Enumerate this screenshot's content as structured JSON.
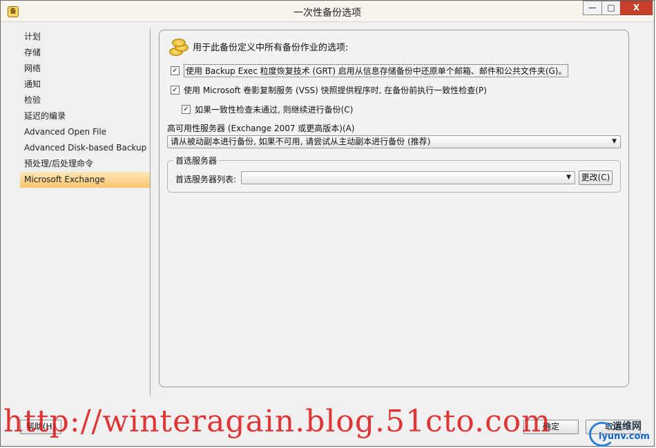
{
  "window": {
    "title": "一次性备份选项",
    "app_icon_glyph": "备",
    "minimize_glyph": "—",
    "maximize_glyph": "□",
    "close_glyph": "X"
  },
  "sidebar": {
    "items": [
      {
        "label": "计划"
      },
      {
        "label": "存储"
      },
      {
        "label": "网络"
      },
      {
        "label": "通知"
      },
      {
        "label": "检验"
      },
      {
        "label": "延迟的编录"
      },
      {
        "label": "Advanced Open File"
      },
      {
        "label": "Advanced Disk-based Backup"
      },
      {
        "label": "预处理/后处理命令"
      },
      {
        "label": "Microsoft Exchange"
      }
    ],
    "selected": "Microsoft Exchange"
  },
  "panel": {
    "title": "用于此备份定义中所有备份作业的选项:",
    "icon": "coins-icon",
    "options": {
      "grt": {
        "label": "使用 Backup Exec 粒度恢复技术 (GRT) 启用从信息存储备份中还原单个邮箱、邮件和公共文件夹(G)。",
        "checked": true
      },
      "vss": {
        "label": "使用 Microsoft 卷影复制服务 (VSS) 快照提供程序时, 在备份前执行一致性检查(P)",
        "checked": true
      },
      "continue": {
        "label": "如果一致性检查未通过, 则继续进行备份(C)",
        "checked": true
      }
    },
    "ha_server": {
      "label": "高可用性服务器 (Exchange 2007 或更高版本)(A)",
      "selected": "请从被动副本进行备份, 如果不可用, 请尝试从主动副本进行备份 (推荐)"
    },
    "preferred_server": {
      "group_label": "首选服务器",
      "list_label": "首选服务器列表:",
      "list_value": "",
      "change_button": "更改(C)"
    }
  },
  "footer": {
    "help_button": "帮助(H)",
    "ok_button": "确定",
    "cancel_button": "取消"
  },
  "overlay": {
    "watermark_text": "http://winteragain.blog.51cto.com",
    "logo_top": "运维网",
    "logo_bottom": "iyunv.com"
  },
  "check_glyph": "✓",
  "arrow_glyph": "▼",
  "colors": {
    "selected_item": "#f9c46f",
    "close_button": "#c7402b",
    "watermark": "#dc1414"
  }
}
